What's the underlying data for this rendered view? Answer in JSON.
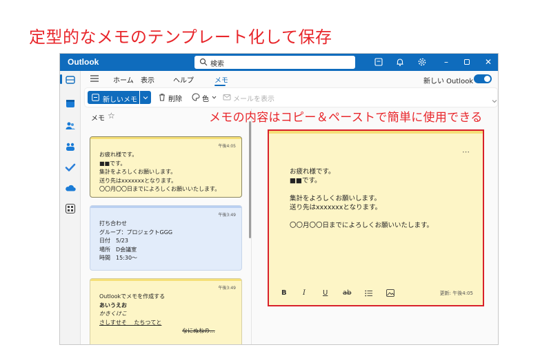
{
  "headline": "定型的なメモのテンプレート化して保存",
  "annotation": "メモの内容はコピー＆ペーストで簡単に使用できる",
  "titlebar": {
    "app_name": "Outlook",
    "search_placeholder": "検索"
  },
  "ribbon": {
    "tabs": [
      "ホーム",
      "表示",
      "ヘルプ",
      "メモ"
    ],
    "active_tab": "メモ",
    "new_outlook_label": "新しい Outlook",
    "new_outlook_enabled": true
  },
  "toolbar": {
    "new_note": "新しいメモ",
    "delete": "削除",
    "color": "色",
    "view_in_mail": "メールを表示"
  },
  "list": {
    "header": "メモ",
    "notes": [
      {
        "time": "午後4:05",
        "color": "yellow",
        "lines": [
          "お疲れ様です。",
          "■■です。",
          "集計をよろしくお願いします。",
          "送り先はxxxxxxxとなります。",
          "〇〇月〇〇日までによろしくお願いいたします。"
        ]
      },
      {
        "time": "午後3:49",
        "color": "blue",
        "lines": [
          "打ち合わせ",
          "グループ：プロジェクトGGG",
          "日付　5/23",
          "場所　D会議室",
          "時間　15:30〜"
        ]
      },
      {
        "time": "午後3:49",
        "color": "yellow",
        "lines": [
          "Outlookでメモを作成する",
          "あいうえお",
          "かきくけこ",
          "さしすせそ　 たちつてと",
          "なにぬねの..."
        ]
      }
    ]
  },
  "detail": {
    "lines": [
      "お疲れ様です。",
      "■■です。",
      "",
      "集計をよろしくお願いします。",
      "送り先はxxxxxxxとなります。",
      "",
      "〇〇月〇〇日までによろしくお願いいたします。"
    ],
    "format_buttons": [
      "B",
      "I",
      "U",
      "ab"
    ],
    "updated": "更新: 午後4:05"
  },
  "colors": {
    "brand": "#0f6cbd",
    "annotation_red": "#e8262b",
    "note_yellow": "#fdf5c6",
    "note_blue": "#e2ecfa"
  }
}
